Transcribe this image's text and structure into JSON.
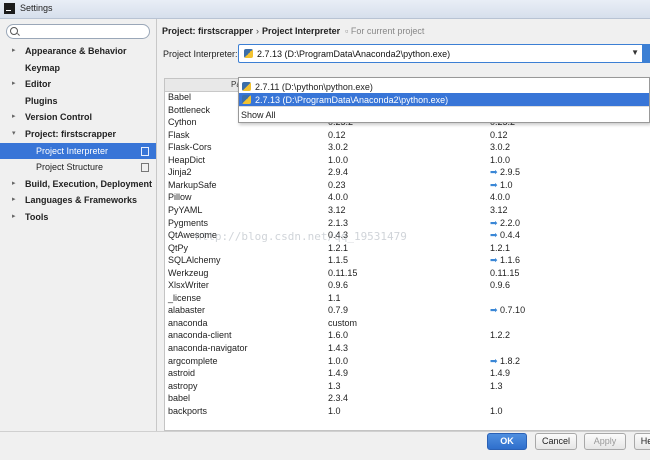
{
  "window": {
    "title": "Settings"
  },
  "search": {
    "placeholder": ""
  },
  "sidebar": {
    "items": [
      {
        "label": "Appearance & Behavior",
        "arrow": "▸"
      },
      {
        "label": "Keymap",
        "arrow": ""
      },
      {
        "label": "Editor",
        "arrow": "▸"
      },
      {
        "label": "Plugins",
        "arrow": ""
      },
      {
        "label": "Version Control",
        "arrow": "▸"
      },
      {
        "label": "Project: firstscrapper",
        "arrow": "▾"
      },
      {
        "label": "Project Interpreter",
        "arrow": ""
      },
      {
        "label": "Project Structure",
        "arrow": ""
      },
      {
        "label": "Build, Execution, Deployment",
        "arrow": "▸"
      },
      {
        "label": "Languages & Frameworks",
        "arrow": "▸"
      },
      {
        "label": "Tools",
        "arrow": "▸"
      }
    ]
  },
  "header": {
    "crumb_project": "Project: firstscrapper",
    "crumb_sep": "›",
    "crumb_page": "Project Interpreter",
    "crumb_note": "For current project"
  },
  "interpreter": {
    "label": "Project Interpreter:",
    "selected": "2.7.13 (D:\\ProgramData\\Anaconda2\\python.exe)"
  },
  "dropdown": {
    "options": [
      "2.7.11 (D:\\python\\python.exe)",
      "2.7.13 (D:\\ProgramData\\Anaconda2\\python.exe)"
    ],
    "show_all": "Show All"
  },
  "table": {
    "header_partial": "Pac",
    "rows": [
      [
        "Babel",
        "",
        "",
        false
      ],
      [
        "Bottleneck",
        "",
        "",
        false
      ],
      [
        "Cython",
        "0.25.2",
        "0.25.2",
        false
      ],
      [
        "Flask",
        "0.12",
        "0.12",
        false
      ],
      [
        "Flask-Cors",
        "3.0.2",
        "3.0.2",
        false
      ],
      [
        "HeapDict",
        "1.0.0",
        "1.0.0",
        false
      ],
      [
        "Jinja2",
        "2.9.4",
        "2.9.5",
        true
      ],
      [
        "MarkupSafe",
        "0.23",
        "1.0",
        true
      ],
      [
        "Pillow",
        "4.0.0",
        "4.0.0",
        false
      ],
      [
        "PyYAML",
        "3.12",
        "3.12",
        false
      ],
      [
        "Pygments",
        "2.1.3",
        "2.2.0",
        true
      ],
      [
        "QtAwesome",
        "0.4.3",
        "0.4.4",
        true
      ],
      [
        "QtPy",
        "1.2.1",
        "1.2.1",
        false
      ],
      [
        "SQLAlchemy",
        "1.1.5",
        "1.1.6",
        true
      ],
      [
        "Werkzeug",
        "0.11.15",
        "0.11.15",
        false
      ],
      [
        "XlsxWriter",
        "0.9.6",
        "0.9.6",
        false
      ],
      [
        "_license",
        "1.1",
        "",
        false
      ],
      [
        "alabaster",
        "0.7.9",
        "0.7.10",
        true
      ],
      [
        "anaconda",
        "custom",
        "",
        false
      ],
      [
        "anaconda-client",
        "1.6.0",
        "1.2.2",
        false
      ],
      [
        "anaconda-navigator",
        "1.4.3",
        "",
        false
      ],
      [
        "argcomplete",
        "1.0.0",
        "1.8.2",
        true
      ],
      [
        "astroid",
        "1.4.9",
        "1.4.9",
        false
      ],
      [
        "astropy",
        "1.3",
        "1.3",
        false
      ],
      [
        "babel",
        "2.3.4",
        "",
        false
      ],
      [
        "backports",
        "1.0",
        "1.0",
        false
      ]
    ]
  },
  "watermark": "http://blog.csdn.net/qq_19531479",
  "buttons": {
    "ok": "OK",
    "cancel": "Cancel",
    "apply": "Apply",
    "help": "Help"
  }
}
